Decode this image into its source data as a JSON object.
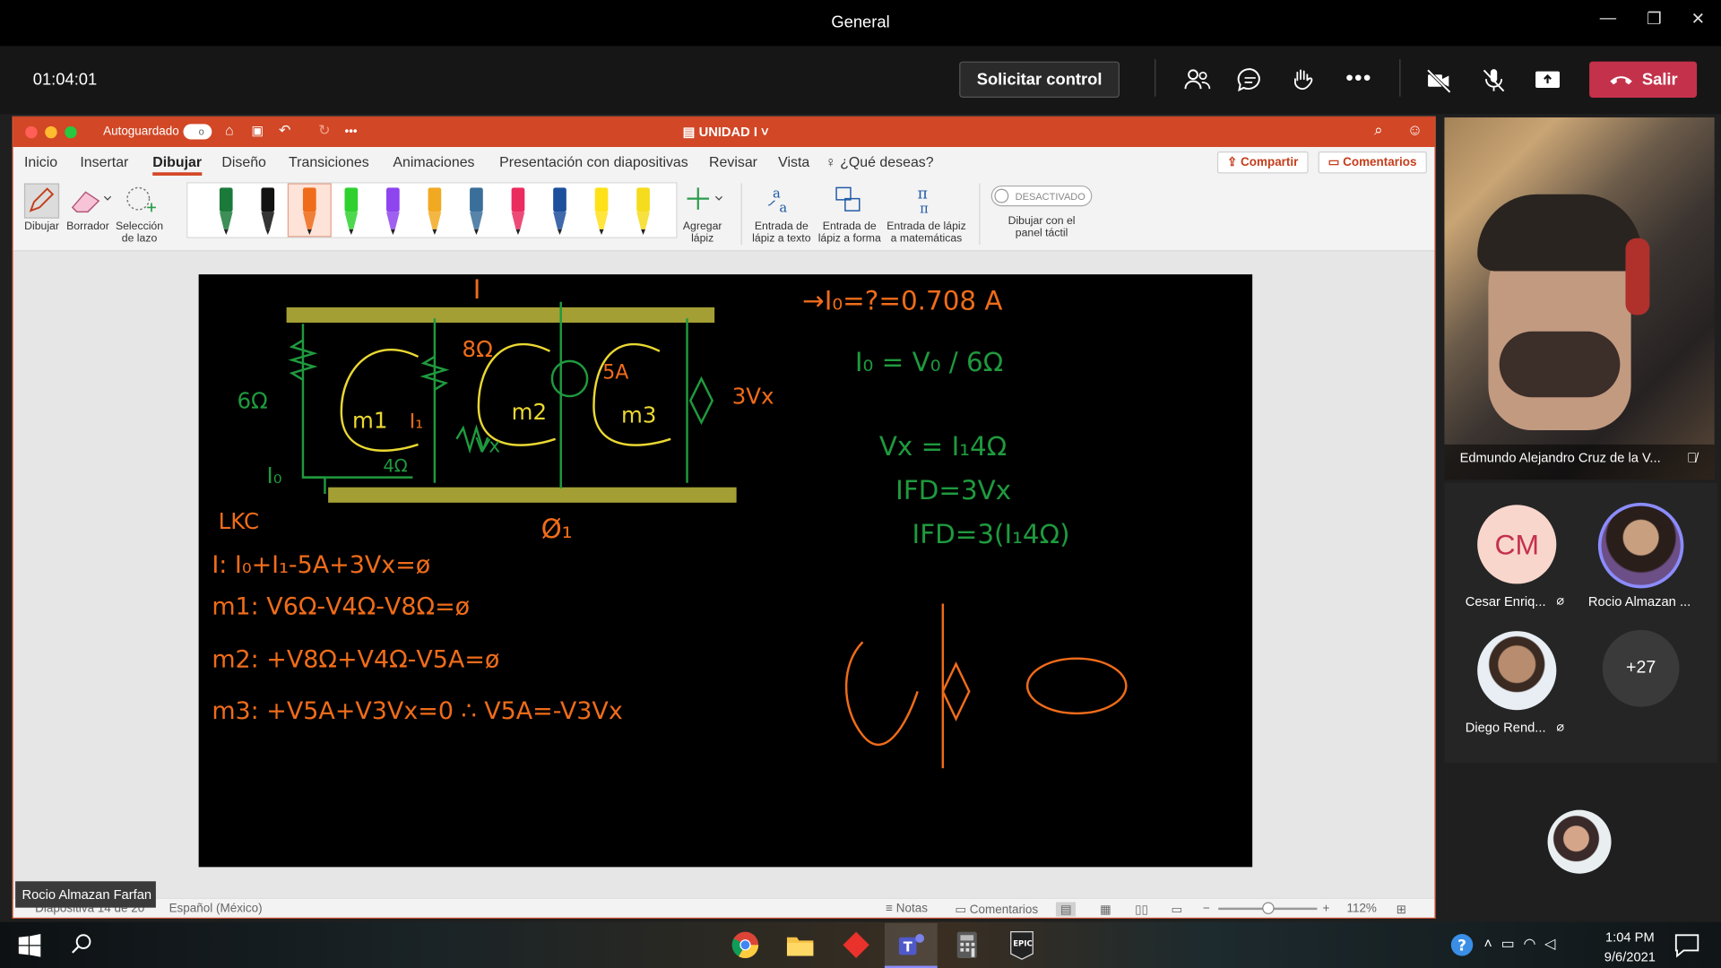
{
  "window": {
    "title": "General"
  },
  "meeting": {
    "timer": "01:04:01",
    "request_control_label": "Solicitar control",
    "leave_label": "Salir"
  },
  "powerpoint": {
    "autosave_label": "Autoguardado",
    "autosave_toggle": "o",
    "doc_title": "UNIDAD I",
    "tabs": [
      "Inicio",
      "Insertar",
      "Dibujar",
      "Diseño",
      "Transiciones",
      "Animaciones",
      "Presentación con diapositivas",
      "Revisar",
      "Vista"
    ],
    "active_tab": "Dibujar",
    "tell_me": "¿Qué deseas?",
    "share_label": "Compartir",
    "comments_label": "Comentarios",
    "ribbon": {
      "draw": "Dibujar",
      "eraser": "Borrador",
      "lasso_1": "Selección",
      "lasso_2": "de lazo",
      "add_pen_1": "Agregar",
      "add_pen_2": "lápiz",
      "ink_text_1": "Entrada de",
      "ink_text_2": "lápiz a texto",
      "ink_shape_1": "Entrada de",
      "ink_shape_2": "lápiz a forma",
      "ink_math_1": "Entrada de lápiz",
      "ink_math_2": "a matemáticas",
      "toggle_label": "DESACTIVADO",
      "touch_1": "Dibujar con el",
      "touch_2": "panel táctil"
    },
    "pen_colors": [
      "#1b7a3a",
      "#111111",
      "#ef6c1a",
      "#2fd12f",
      "#8e44ef",
      "#f2a922",
      "#3a6f9a",
      "#ea2c5f",
      "#1e4f9c",
      "#ffe11a",
      "#f5dc1c"
    ],
    "status": {
      "slide": "Diapositiva 14 de 20",
      "language": "Español (México)",
      "notes": "Notas",
      "comments": "Comentarios",
      "zoom": "112%"
    }
  },
  "slide_ink": {
    "left_eqs": [
      "LKC",
      "I:  I₀+I₁-5A+3Vx=ø",
      "m1:  V6Ω-V4Ω-V8Ω=ø",
      "m2:  +V8Ω+V4Ω-V5A=ø",
      "m3:  +V5A+V3Vx=0  ∴  V5A=-V3Vx"
    ],
    "right_eqs": [
      "→I₀=?=0.708 A",
      "I₀ = V₀ / 6Ω",
      "Vx = I₁4Ω",
      "IFD=3Vx",
      "IFD=3(I₁4Ω)"
    ],
    "circuit_labels": [
      "I",
      "8Ω",
      "5A",
      "6Ω",
      "3Vx",
      "m1",
      "m2",
      "m3",
      "I₁",
      "Vx",
      "4Ω",
      "I₀",
      "Ø₁"
    ]
  },
  "presenter_label": "Rocio Almazan Farfan",
  "participants": {
    "featured_name": "Edmundo Alejandro Cruz de la V...",
    "list": [
      {
        "initials": "CM",
        "name": "Cesar Enriq...",
        "color": "#f9d6cc"
      },
      {
        "initials": "",
        "name": "Rocio Almazan ...",
        "color": "#7a5a8a"
      },
      {
        "initials": "",
        "name": "Diego Rend...",
        "color": "#dfe7ee"
      }
    ],
    "more": "+27"
  },
  "taskbar": {
    "time": "1:04 PM",
    "date": "9/6/2021",
    "apps": [
      "windows-start",
      "search",
      "chrome",
      "file-explorer",
      "red-app",
      "teams",
      "calculator",
      "epic-games"
    ]
  }
}
